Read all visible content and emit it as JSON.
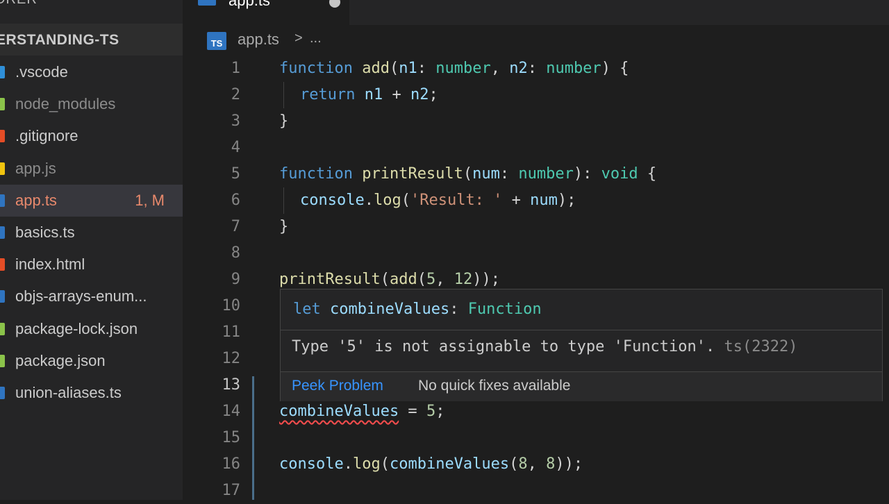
{
  "sidebar": {
    "title": "ORER",
    "section": "ERSTANDING-TS",
    "files": [
      {
        "name": ".vscode",
        "icon_color": "#2f8fd8",
        "style": "normal"
      },
      {
        "name": "node_modules",
        "icon_color": "#8bc34a",
        "style": "dim"
      },
      {
        "name": ".gitignore",
        "icon_color": "#e44d26",
        "style": "normal"
      },
      {
        "name": "app.js",
        "icon_color": "#f1c40f",
        "style": "dim"
      },
      {
        "name": "app.ts",
        "icon_color": "#2f74c0",
        "style": "error",
        "badge": "1, M"
      },
      {
        "name": "basics.ts",
        "icon_color": "#2f74c0",
        "style": "normal"
      },
      {
        "name": "index.html",
        "icon_color": "#e44d26",
        "style": "normal"
      },
      {
        "name": "objs-arrays-enum...",
        "icon_color": "#2f74c0",
        "style": "normal"
      },
      {
        "name": "package-lock.json",
        "icon_color": "#8bc34a",
        "style": "normal"
      },
      {
        "name": "package.json",
        "icon_color": "#8bc34a",
        "style": "normal"
      },
      {
        "name": "union-aliases.ts",
        "icon_color": "#2f74c0",
        "style": "normal"
      }
    ]
  },
  "tab": {
    "name": "app.ts"
  },
  "breadcrumb": {
    "icon": "TS",
    "file": "app.ts",
    "separator": ">",
    "more": "..."
  },
  "editor": {
    "current_line": 13,
    "lines": [
      {
        "n": "1"
      },
      {
        "n": "2"
      },
      {
        "n": "3"
      },
      {
        "n": "4"
      },
      {
        "n": "5"
      },
      {
        "n": "6"
      },
      {
        "n": "7"
      },
      {
        "n": "8"
      },
      {
        "n": "9"
      },
      {
        "n": "10"
      },
      {
        "n": "11"
      },
      {
        "n": "12"
      },
      {
        "n": "13"
      },
      {
        "n": "14"
      },
      {
        "n": "15"
      },
      {
        "n": "16"
      },
      {
        "n": "17"
      }
    ],
    "code": {
      "l1": [
        "function",
        " ",
        "add",
        "(",
        "n1",
        ": ",
        "number",
        ", ",
        "n2",
        ": ",
        "number",
        ") {"
      ],
      "l2": [
        "return",
        " ",
        "n1",
        " + ",
        "n2",
        ";"
      ],
      "l3": [
        "}"
      ],
      "l5": [
        "function",
        " ",
        "printResult",
        "(",
        "num",
        ": ",
        "number",
        "): ",
        "void",
        " {"
      ],
      "l6": [
        "console",
        ".",
        "log",
        "(",
        "'Result: '",
        " + ",
        "num",
        ");"
      ],
      "l7": [
        "}"
      ],
      "l9": [
        "printResult",
        "(",
        "add",
        "(",
        "5",
        ", ",
        "12",
        "));"
      ],
      "l14": [
        "combineValues",
        " = ",
        "5",
        ";"
      ],
      "l16": [
        "console",
        ".",
        "log",
        "(",
        "combineValues",
        "(",
        "8",
        ", ",
        "8",
        "));"
      ]
    }
  },
  "hover": {
    "sig_keyword": "let",
    "sig_name": "combineValues",
    "sig_colon": ":",
    "sig_type": "Function",
    "message": "Type '5' is not assignable to type 'Function'.",
    "code": "ts(2322)",
    "peek_label": "Peek Problem",
    "nofix_label": "No quick fixes available"
  }
}
